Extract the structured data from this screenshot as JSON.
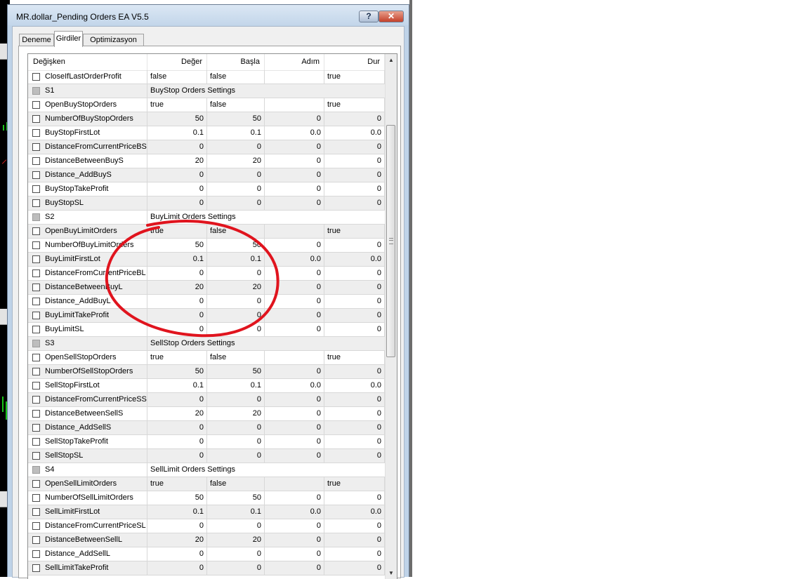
{
  "window": {
    "title": "MR.dollar_Pending Orders EA V5.5",
    "help_label": "?",
    "close_label": "✕"
  },
  "tabs": [
    {
      "label": "Deneme",
      "active": false
    },
    {
      "label": "Girdiler",
      "active": true
    },
    {
      "label": "Optimizasyon",
      "active": false
    }
  ],
  "columns": [
    "Değişken",
    "Değer",
    "Başla",
    "Adım",
    "Dur"
  ],
  "rows": [
    {
      "type": "param",
      "name": "CloseIfLastOrderProfit",
      "value": "false",
      "start": "false",
      "step": "",
      "stop": "true"
    },
    {
      "type": "section",
      "name": "S1",
      "caption": "BuyStop Orders Settings"
    },
    {
      "type": "param",
      "name": "OpenBuyStopOrders",
      "value": "true",
      "start": "false",
      "step": "",
      "stop": "true"
    },
    {
      "type": "param",
      "name": "NumberOfBuyStopOrders",
      "value": "50",
      "start": "50",
      "step": "0",
      "stop": "0"
    },
    {
      "type": "param",
      "name": "BuyStopFirstLot",
      "value": "0.1",
      "start": "0.1",
      "step": "0.0",
      "stop": "0.0"
    },
    {
      "type": "param",
      "name": "DistanceFromCurrentPriceBS",
      "value": "0",
      "start": "0",
      "step": "0",
      "stop": "0"
    },
    {
      "type": "param",
      "name": "DistanceBetweenBuyS",
      "value": "20",
      "start": "20",
      "step": "0",
      "stop": "0"
    },
    {
      "type": "param",
      "name": "Distance_AddBuyS",
      "value": "0",
      "start": "0",
      "step": "0",
      "stop": "0"
    },
    {
      "type": "param",
      "name": "BuyStopTakeProfit",
      "value": "0",
      "start": "0",
      "step": "0",
      "stop": "0"
    },
    {
      "type": "param",
      "name": "BuyStopSL",
      "value": "0",
      "start": "0",
      "step": "0",
      "stop": "0"
    },
    {
      "type": "section",
      "name": "S2",
      "caption": "BuyLimit Orders Settings"
    },
    {
      "type": "param",
      "name": "OpenBuyLimitOrders",
      "value": "true",
      "start": "false",
      "step": "",
      "stop": "true"
    },
    {
      "type": "param",
      "name": "NumberOfBuyLimitOrders",
      "value": "50",
      "start": "50",
      "step": "0",
      "stop": "0"
    },
    {
      "type": "param",
      "name": "BuyLimitFirstLot",
      "value": "0.1",
      "start": "0.1",
      "step": "0.0",
      "stop": "0.0"
    },
    {
      "type": "param",
      "name": "DistanceFromCurrentPriceBL",
      "value": "0",
      "start": "0",
      "step": "0",
      "stop": "0"
    },
    {
      "type": "param",
      "name": "DistanceBetweenBuyL",
      "value": "20",
      "start": "20",
      "step": "0",
      "stop": "0"
    },
    {
      "type": "param",
      "name": "Distance_AddBuyL",
      "value": "0",
      "start": "0",
      "step": "0",
      "stop": "0"
    },
    {
      "type": "param",
      "name": "BuyLimitTakeProfit",
      "value": "0",
      "start": "0",
      "step": "0",
      "stop": "0"
    },
    {
      "type": "param",
      "name": "BuyLimitSL",
      "value": "0",
      "start": "0",
      "step": "0",
      "stop": "0"
    },
    {
      "type": "section",
      "name": "S3",
      "caption": "SellStop Orders Settings"
    },
    {
      "type": "param",
      "name": "OpenSellStopOrders",
      "value": "true",
      "start": "false",
      "step": "",
      "stop": "true"
    },
    {
      "type": "param",
      "name": "NumberOfSellStopOrders",
      "value": "50",
      "start": "50",
      "step": "0",
      "stop": "0"
    },
    {
      "type": "param",
      "name": "SellStopFirstLot",
      "value": "0.1",
      "start": "0.1",
      "step": "0.0",
      "stop": "0.0"
    },
    {
      "type": "param",
      "name": "DistanceFromCurrentPriceSS",
      "value": "0",
      "start": "0",
      "step": "0",
      "stop": "0"
    },
    {
      "type": "param",
      "name": "DistanceBetweenSellS",
      "value": "20",
      "start": "20",
      "step": "0",
      "stop": "0"
    },
    {
      "type": "param",
      "name": "Distance_AddSellS",
      "value": "0",
      "start": "0",
      "step": "0",
      "stop": "0"
    },
    {
      "type": "param",
      "name": "SellStopTakeProfit",
      "value": "0",
      "start": "0",
      "step": "0",
      "stop": "0"
    },
    {
      "type": "param",
      "name": "SellStopSL",
      "value": "0",
      "start": "0",
      "step": "0",
      "stop": "0"
    },
    {
      "type": "section",
      "name": "S4",
      "caption": "SellLimit Orders Settings"
    },
    {
      "type": "param",
      "name": "OpenSellLimitOrders",
      "value": "true",
      "start": "false",
      "step": "",
      "stop": "true"
    },
    {
      "type": "param",
      "name": "NumberOfSellLimitOrders",
      "value": "50",
      "start": "50",
      "step": "0",
      "stop": "0"
    },
    {
      "type": "param",
      "name": "SellLimitFirstLot",
      "value": "0.1",
      "start": "0.1",
      "step": "0.0",
      "stop": "0.0"
    },
    {
      "type": "param",
      "name": "DistanceFromCurrentPriceSL",
      "value": "0",
      "start": "0",
      "step": "0",
      "stop": "0"
    },
    {
      "type": "param",
      "name": "DistanceBetweenSellL",
      "value": "20",
      "start": "20",
      "step": "0",
      "stop": "0"
    },
    {
      "type": "param",
      "name": "Distance_AddSellL",
      "value": "0",
      "start": "0",
      "step": "0",
      "stop": "0"
    },
    {
      "type": "param",
      "name": "SellLimitTakeProfit",
      "value": "0",
      "start": "0",
      "step": "0",
      "stop": "0"
    }
  ],
  "annotation": {
    "color": "#e0141e"
  },
  "icons": {
    "scroll_up": "triangle-up-icon",
    "scroll_down": "triangle-down-icon",
    "help": "question-mark-icon",
    "close": "close-icon"
  }
}
